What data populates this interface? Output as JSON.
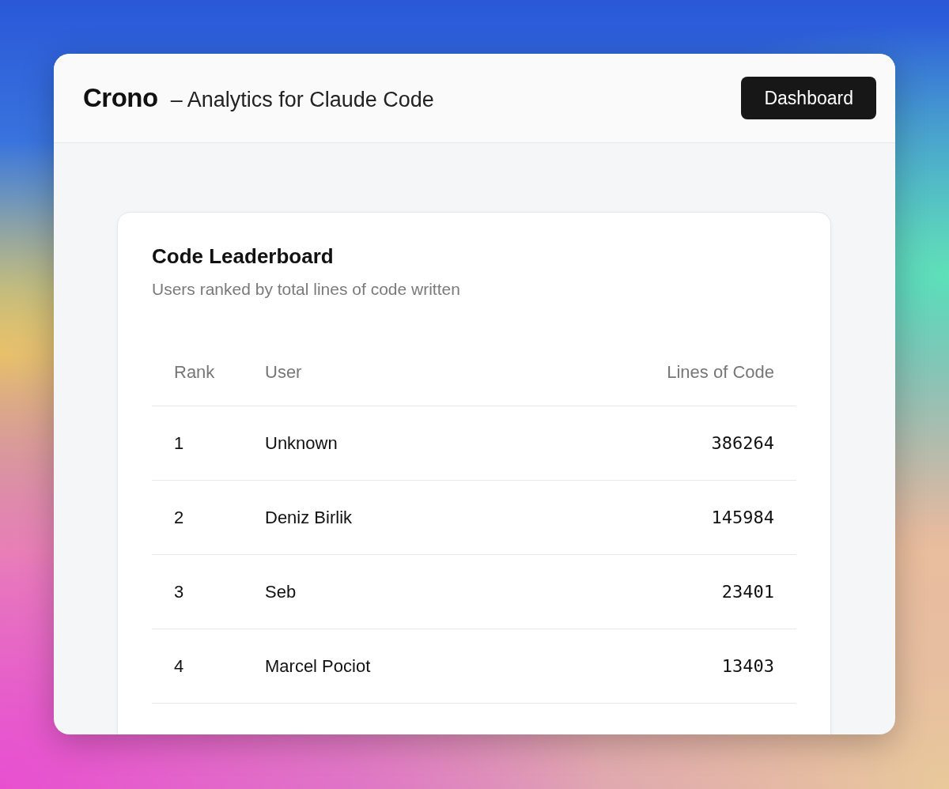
{
  "header": {
    "brand": "Crono",
    "tagline": "– Analytics for Claude Code",
    "button": "Dashboard"
  },
  "leaderboard": {
    "title": "Code Leaderboard",
    "subtitle": "Users ranked by total lines of code written",
    "columns": [
      "Rank",
      "User",
      "Lines of Code"
    ],
    "rows": [
      {
        "rank": "1",
        "user": "Unknown",
        "lines": "386264"
      },
      {
        "rank": "2",
        "user": "Deniz Birlik",
        "lines": "145984"
      },
      {
        "rank": "3",
        "user": "Seb",
        "lines": "23401"
      },
      {
        "rank": "4",
        "user": "Marcel Pociot",
        "lines": "13403"
      }
    ]
  }
}
